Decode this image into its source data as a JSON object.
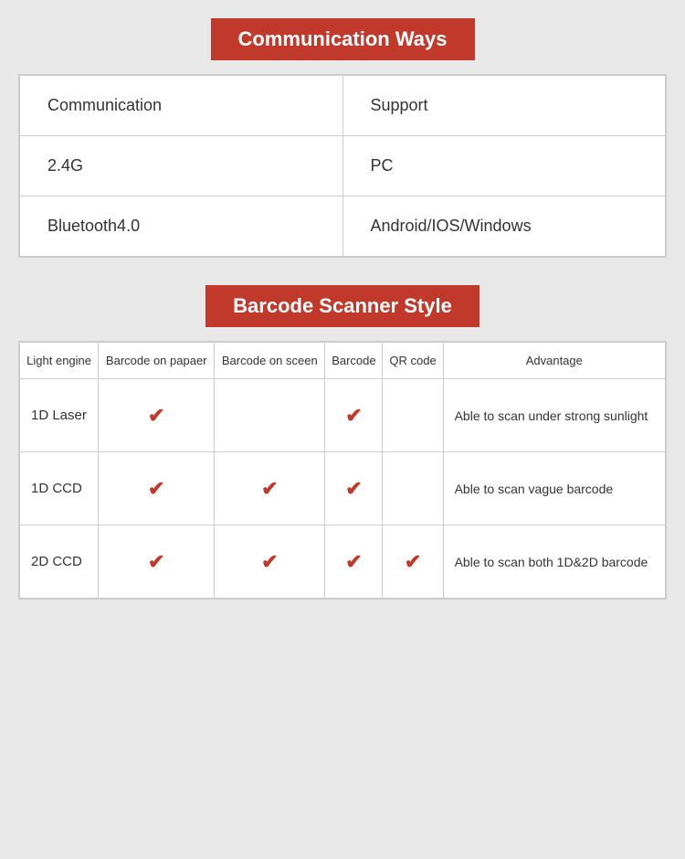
{
  "communication_section": {
    "title": "Communication Ways",
    "table": {
      "headers": [
        "Communication",
        "Support"
      ],
      "rows": [
        [
          "2.4G",
          "PC"
        ],
        [
          "Bluetooth4.0",
          "Android/IOS/Windows"
        ]
      ]
    }
  },
  "barcode_section": {
    "title": "Barcode Scanner Style",
    "table": {
      "headers": [
        "Light engine",
        "Barcode on papaer",
        "Barcode on sceen",
        "Barcode",
        "QR code",
        "Advantage"
      ],
      "rows": [
        {
          "label": "1D Laser",
          "checks": [
            true,
            false,
            true,
            false
          ],
          "advantage": "Able to scan under strong sunlight"
        },
        {
          "label": "1D CCD",
          "checks": [
            true,
            true,
            true,
            false
          ],
          "advantage": "Able to scan vague barcode"
        },
        {
          "label": "2D CCD",
          "checks": [
            true,
            true,
            true,
            true
          ],
          "advantage": "Able to scan both 1D&2D barcode"
        }
      ]
    }
  },
  "checkmark": "✔"
}
